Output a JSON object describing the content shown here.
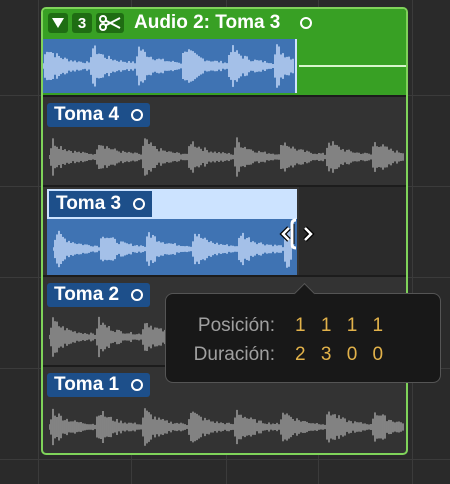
{
  "folder": {
    "disclosure_icon": "triangle-down-icon",
    "take_count": "3",
    "scissors_icon": "scissors-icon",
    "title": "Audio 2: Toma 3"
  },
  "takes": [
    {
      "label": "Toma 4"
    },
    {
      "label": "Toma 3",
      "selected": true
    },
    {
      "label": "Toma 2"
    },
    {
      "label": "Toma 1"
    }
  ],
  "tooltip": {
    "position_label": "Posición:",
    "position_value": "1 1 1 1",
    "duration_label": "Duración:",
    "duration_value": "2 3 0 0"
  },
  "colors": {
    "folder_green": "#38a024",
    "region_blue": "#3f73b3",
    "selected_header": "#cce3ff",
    "tooltip_value": "#e2b24a"
  }
}
